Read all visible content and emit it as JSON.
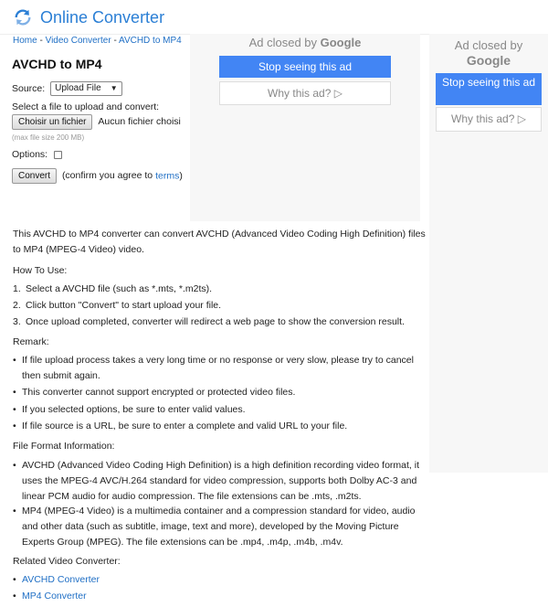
{
  "header": {
    "logo_text": "Online Converter"
  },
  "breadcrumb": [
    "Home",
    "Video Converter",
    "AVCHD to MP4"
  ],
  "page_title": "AVCHD to MP4",
  "form": {
    "source_label": "Source:",
    "source_selected": "Upload File",
    "file_prompt": "Select a file to upload and convert:",
    "file_button": "Choisir un fichier",
    "file_status": "Aucun fichier choisi",
    "max_size_hint": "(max file size 200 MB)",
    "options_label": "Options:",
    "convert_button": "Convert",
    "confirm_text": "(confirm you agree to ",
    "terms_link": "terms",
    "confirm_end": ")"
  },
  "ad_main": {
    "closed_prefix": "Ad closed by ",
    "closed_brand": "Google",
    "stop_button": "Stop seeing this ad",
    "why_button": "Why this ad? ▷"
  },
  "ad_side": {
    "closed_prefix": "Ad closed by",
    "closed_brand": "Google",
    "stop_button": "Stop seeing this ad",
    "why_button": "Why this ad? ▷"
  },
  "intro": "This AVCHD to MP4 converter can convert AVCHD (Advanced Video Coding High Definition) files to MP4 (MPEG-4 Video) video.",
  "howto": {
    "heading": "How To Use:",
    "steps": [
      "Select a AVCHD file (such as *.mts, *.m2ts).",
      "Click button \"Convert\" to start upload your file.",
      "Once upload completed, converter will redirect a web page to show the conversion result."
    ]
  },
  "remark": {
    "heading": "Remark:",
    "items": [
      "If file upload process takes a very long time or no response or very slow, please try to cancel then submit again.",
      "This converter cannot support encrypted or protected video files.",
      "If you selected options, be sure to enter valid values.",
      "If file source is a URL, be sure to enter a complete and valid URL to your file."
    ]
  },
  "format_info": {
    "heading": "File Format Information:",
    "items": [
      "AVCHD (Advanced Video Coding High Definition) is a high definition recording video format, it uses the MPEG-4 AVC/H.264 standard for video compression, supports both Dolby AC-3 and linear PCM audio for audio compression. The file extensions can be .mts, .m2ts.",
      "MP4 (MPEG-4 Video) is a multimedia container and a compression standard for video, audio and other data (such as subtitle, image, text and more), developed by the Moving Picture Experts Group (MPEG). The file extensions can be .mp4, .m4p, .m4b, .m4v."
    ]
  },
  "related": {
    "heading": "Related Video Converter:",
    "links": [
      "AVCHD Converter",
      "MP4 Converter"
    ]
  },
  "colors": {
    "brand": "#2b7fd5",
    "link": "#1f6fc5",
    "ad_blue": "#4285f4"
  }
}
